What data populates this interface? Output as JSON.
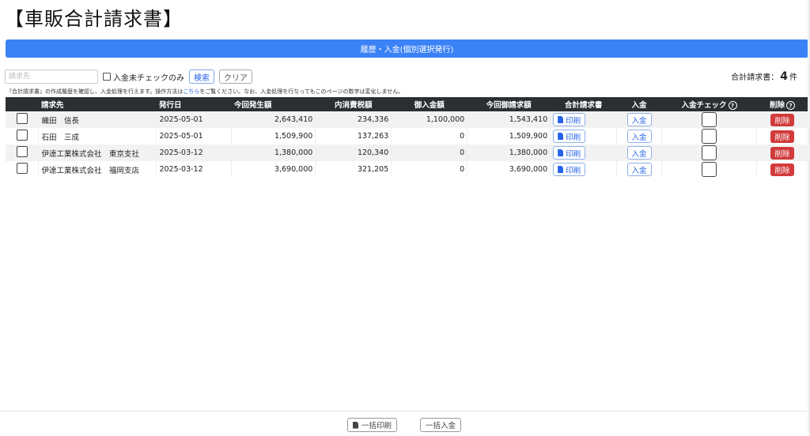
{
  "page": {
    "title": "【車販合計請求書】"
  },
  "history_button": {
    "label": "履歴・入金(個別選択発行)"
  },
  "filter": {
    "placeholder": "請求先",
    "unpaid_only_label": "入金未チェックのみ",
    "search_label": "検索",
    "clear_label": "クリア"
  },
  "count": {
    "label": "合計請求書：",
    "value": "4",
    "unit": "件"
  },
  "note": {
    "before": "『合計請求書』の作成履歴を確認し、入金処理を行えます。操作方法は",
    "link": "こちら",
    "after": "をご覧ください。なお、入金処理を行なってもこのページの数字は変化しません。"
  },
  "table": {
    "headers": {
      "customer": "請求先",
      "issue_date": "発行日",
      "amount": "今回発生額",
      "tax": "内消費税額",
      "paid": "御入金額",
      "billed": "今回御請求額",
      "invoice": "合計請求書",
      "payment": "入金",
      "payment_check": "入金チェック",
      "delete": "削除"
    },
    "rows": [
      {
        "customer": "織田　信長",
        "issue_date": "2025-05-01",
        "amount": "2,643,410",
        "tax": "234,336",
        "paid": "1,100,000",
        "billed": "1,543,410",
        "print_label": "印刷",
        "pay_label": "入金",
        "delete_label": "削除"
      },
      {
        "customer": "石田　三成",
        "issue_date": "2025-05-01",
        "amount": "1,509,900",
        "tax": "137,263",
        "paid": "0",
        "billed": "1,509,900",
        "print_label": "印刷",
        "pay_label": "入金",
        "delete_label": "削除"
      },
      {
        "customer": "伊達工業株式会社　東京支社",
        "issue_date": "2025-03-12",
        "amount": "1,380,000",
        "tax": "120,340",
        "paid": "0",
        "billed": "1,380,000",
        "print_label": "印刷",
        "pay_label": "入金",
        "delete_label": "削除"
      },
      {
        "customer": "伊達工業株式会社　福岡支店",
        "issue_date": "2025-03-12",
        "amount": "3,690,000",
        "tax": "321,205",
        "paid": "0",
        "billed": "3,690,000",
        "print_label": "印刷",
        "pay_label": "入金",
        "delete_label": "削除"
      }
    ]
  },
  "footer": {
    "bulk_print_label": "一括印刷",
    "bulk_pay_label": "一括入金"
  },
  "colors": {
    "primary": "#3b82f6",
    "header_bg": "#2b2f33",
    "danger": "#d23b3b",
    "link": "#2563eb"
  },
  "icons": {
    "print": "pdf-file-icon",
    "help": "question-circle-icon"
  }
}
